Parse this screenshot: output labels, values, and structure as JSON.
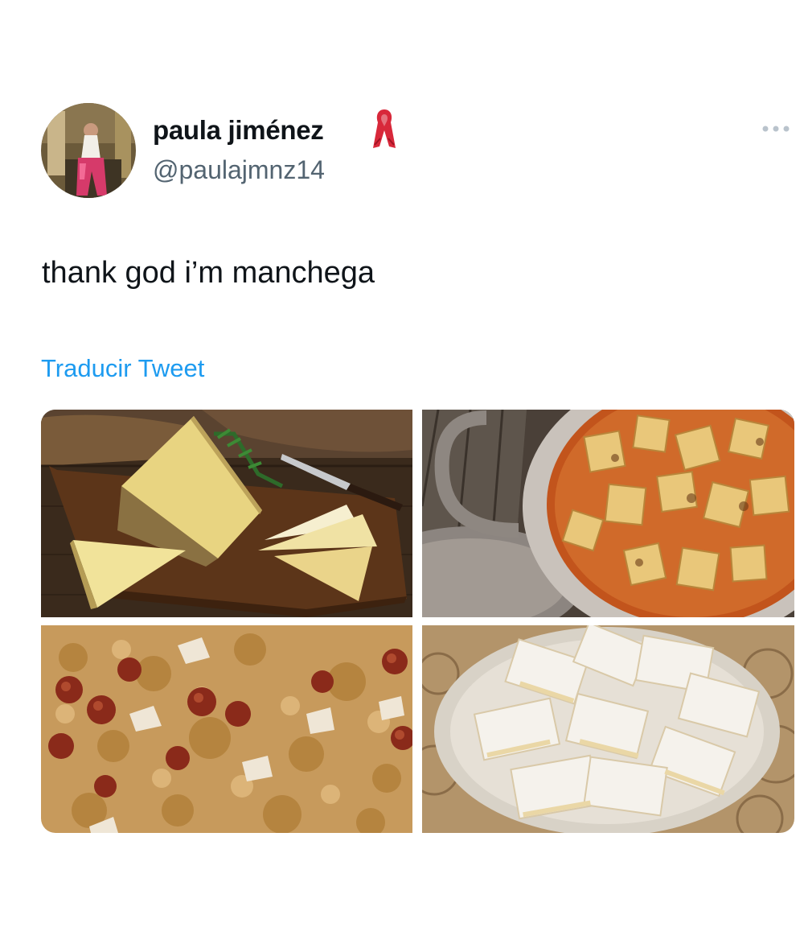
{
  "tweet": {
    "display_name": "paula jiménez",
    "name_badge_icon": "red-ribbon-icon",
    "handle": "@paulajmnz14",
    "text": "thank god i’m manchega",
    "translate_label": "Traducir Tweet",
    "more_icon": "more-options-icon",
    "accent_color": "#1d9bf0",
    "media": [
      {
        "subject": "queso-manchego"
      },
      {
        "subject": "gachas-stew"
      },
      {
        "subject": "migas-con-chorizo"
      },
      {
        "subject": "miguelitos-pastries"
      }
    ]
  }
}
